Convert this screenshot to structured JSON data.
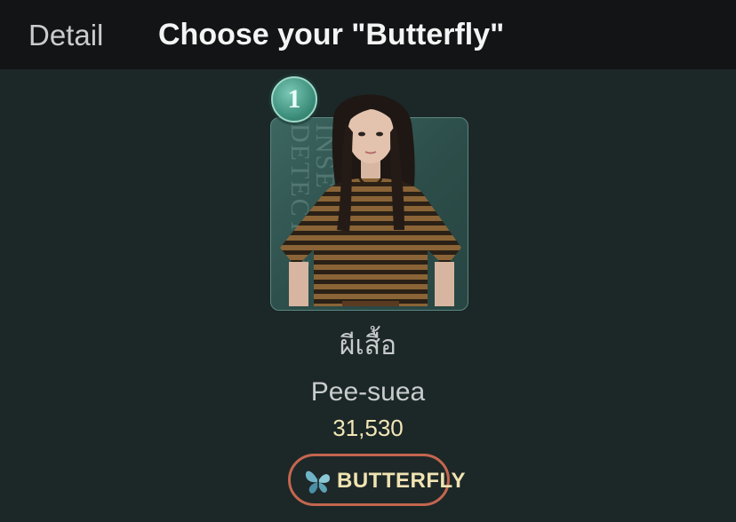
{
  "header": {
    "back_label": "Detail",
    "title": "Choose your \"Butterfly\""
  },
  "candidate": {
    "rank": "1",
    "card_background_text": "INSE DETECTIV",
    "name_thai": "ผีเสื้อ",
    "name_en": "Pee-suea",
    "votes": "31,530",
    "vote_button_label": "BUTTERFLY",
    "vote_button_icon": "butterfly-icon"
  },
  "colors": {
    "background": "#1c2727",
    "header_background": "#131415",
    "votes_text": "#f1e6b6",
    "button_border": "#c4664f",
    "badge": "#3c8c7a"
  }
}
